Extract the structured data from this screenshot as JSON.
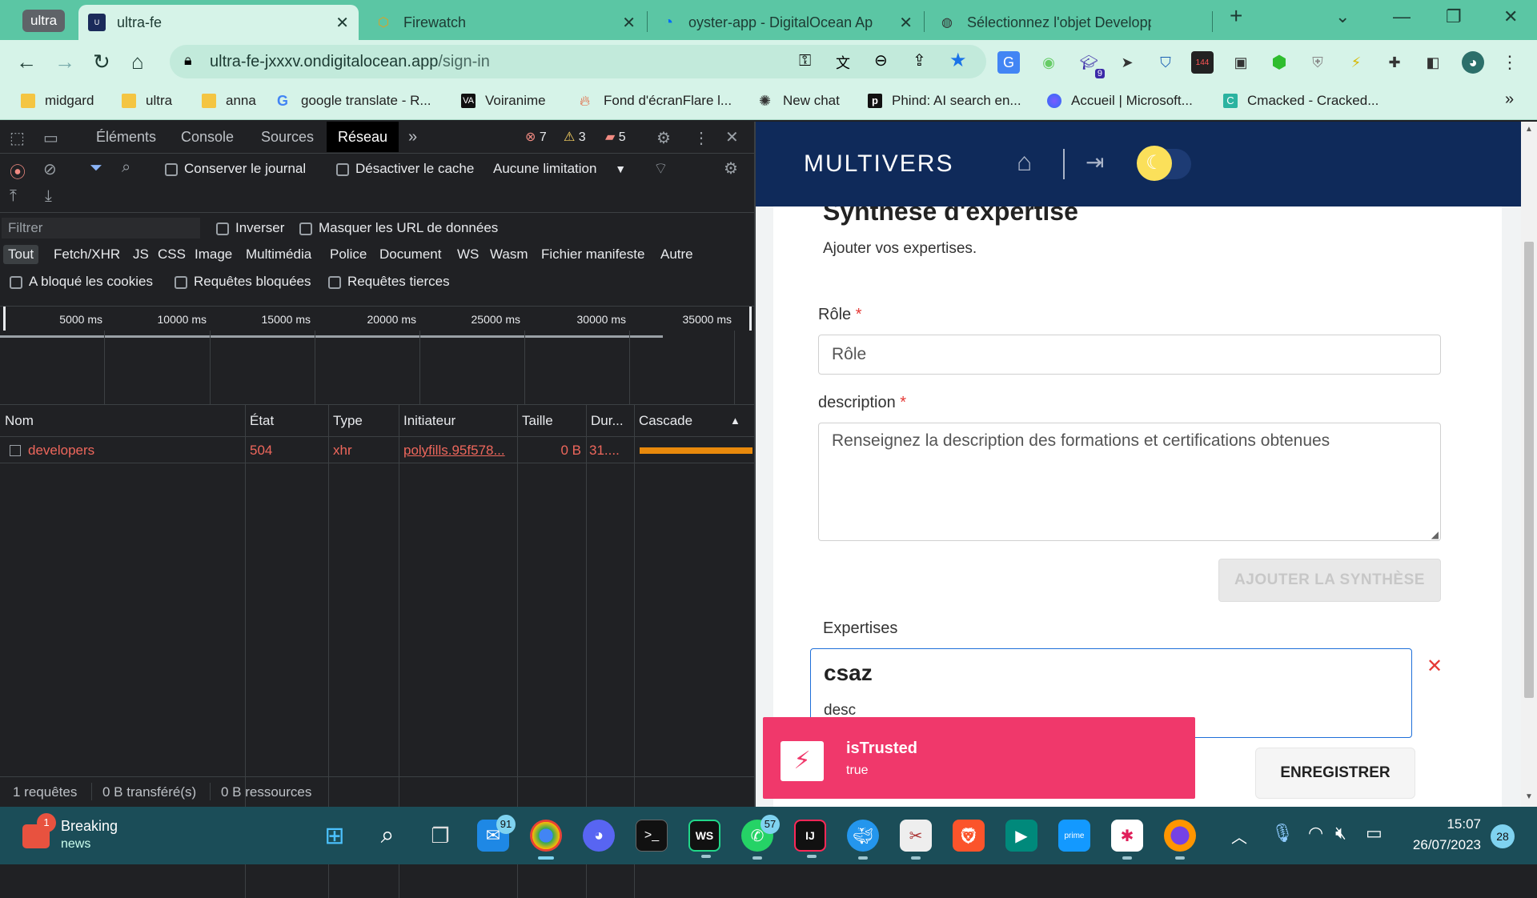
{
  "browser": {
    "tab_group": "ultra",
    "tabs": [
      {
        "title": "ultra-fe",
        "favicon": "ultra-favicon-icon",
        "active": true
      },
      {
        "title": "Firewatch",
        "favicon": "hexagon-icon",
        "active": false
      },
      {
        "title": "oyster-app - DigitalOcean App P",
        "favicon": "digitalocean-icon",
        "active": false
      },
      {
        "title": "Sélectionnez l'objet Developpeur",
        "favicon": "globe-icon",
        "active": false
      }
    ],
    "new_tab": "+",
    "url_host": "ultra-fe-jxxxv.ondigitalocean.app",
    "url_path": "/sign-in",
    "bookmarks": [
      {
        "label": "midgard",
        "icon": "folder-icon"
      },
      {
        "label": "ultra",
        "icon": "folder-icon"
      },
      {
        "label": "anna",
        "icon": "folder-icon"
      },
      {
        "label": "google translate - R...",
        "icon": "google-icon"
      },
      {
        "label": "Voiranime",
        "icon": "voiranime-icon"
      },
      {
        "label": "Fond d'écranFlare l...",
        "icon": "flame-icon"
      },
      {
        "label": "New chat",
        "icon": "openai-icon"
      },
      {
        "label": "Phind: AI search en...",
        "icon": "phind-icon"
      },
      {
        "label": "Accueil | Microsoft...",
        "icon": "microsoft-icon"
      },
      {
        "label": "Cmacked - Cracked...",
        "icon": "cmacked-icon"
      }
    ],
    "more_bookmarks": "»",
    "extension_badge_count": "9",
    "extension_badge_144": "144"
  },
  "devtools": {
    "tabs": [
      "Éléments",
      "Console",
      "Sources",
      "Réseau"
    ],
    "active_tab": "Réseau",
    "more_tabs": "»",
    "errors": "7",
    "warnings": "3",
    "issues": "5",
    "preserve_log": "Conserver le journal",
    "disable_cache": "Désactiver le cache",
    "throttling": "Aucune limitation",
    "filter_placeholder": "Filtrer",
    "invert": "Inverser",
    "hide_data_urls": "Masquer les URL de données",
    "type_filters": [
      "Tout",
      "Fetch/XHR",
      "JS",
      "CSS",
      "Image",
      "Multimédia",
      "Police",
      "Document",
      "WS",
      "Wasm",
      "Fichier manifeste",
      "Autre"
    ],
    "blocked_cookies": "A bloqué les cookies",
    "blocked_requests": "Requêtes bloquées",
    "third_party": "Requêtes tierces",
    "timeline_ticks": [
      "5000 ms",
      "10000 ms",
      "15000 ms",
      "20000 ms",
      "25000 ms",
      "30000 ms",
      "35000 ms"
    ],
    "columns": [
      "Nom",
      "État",
      "Type",
      "Initiateur",
      "Taille",
      "Dur...",
      "Cascade"
    ],
    "rows": [
      {
        "name": "developers",
        "status": "504",
        "type": "xhr",
        "initiator": "polyfills.95f578...",
        "size": "0 B",
        "duration": "31...."
      }
    ],
    "summary": {
      "requests": "1 requêtes",
      "transferred": "0 B transféré(s)",
      "resources": "0 B ressources"
    }
  },
  "app": {
    "logo": "MULTIVERS",
    "section_title": "Synthèse d'expertise",
    "section_subtitle": "Ajouter vos expertises.",
    "role_label": "Rôle",
    "role_placeholder": "Rôle",
    "required_mark": "*",
    "description_label": "description",
    "description_placeholder": "Renseignez la description des formations et certifications obtenues",
    "add_button": "AJOUTER LA SYNTHÈSE",
    "expertises_label": "Expertises",
    "expertise_item": {
      "title": "csaz",
      "desc": "desc"
    },
    "save_button": "ENREGISTRER"
  },
  "toast": {
    "title": "isTrusted",
    "message": "true"
  },
  "taskbar": {
    "news_title": "Breaking",
    "news_subtitle": "news",
    "news_badge": "1",
    "mail_badge": "91",
    "whatsapp_badge": "57",
    "time": "15:07",
    "date": "26/07/2023",
    "notification_count": "28"
  },
  "colors": {
    "tab_strip": "#5bc6a4",
    "toolbar": "#d6f3e8",
    "app_header": "#0f2a5a",
    "toast": "#f0386b",
    "error_red": "#ee675c",
    "cascade_bar": "#e8890c"
  }
}
